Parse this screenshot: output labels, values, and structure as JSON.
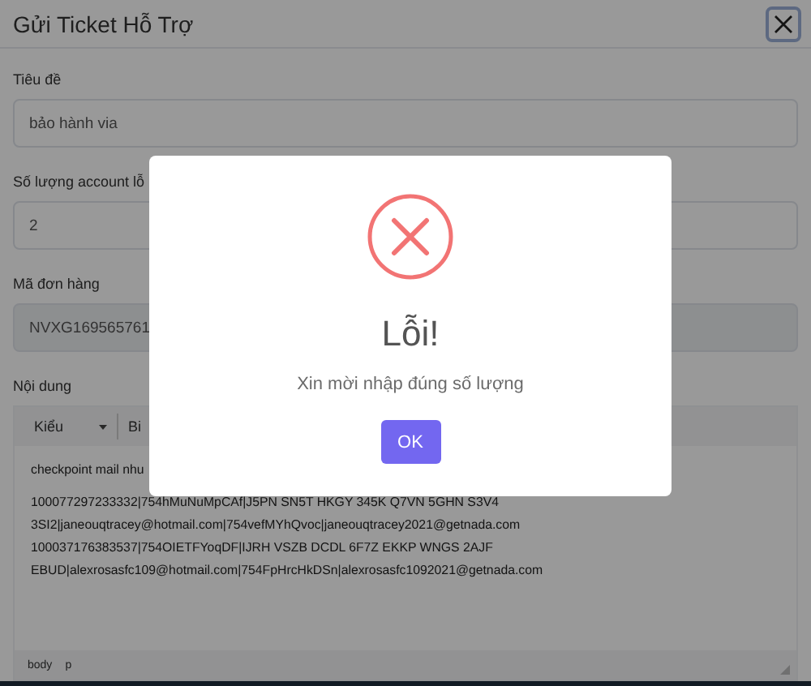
{
  "modal": {
    "title": "Gửi Ticket Hỗ Trợ",
    "fields": [
      {
        "label": "Tiêu đề",
        "value": "bảo hành via",
        "disabled": false
      },
      {
        "label": "Số lượng account lỗ",
        "value": "2",
        "disabled": false
      },
      {
        "label": "Mã đơn hàng",
        "value": "NVXG169565761",
        "disabled": true
      }
    ],
    "editor": {
      "label": "Nội dung",
      "style_dropdown": "Kiểu",
      "toolbar_text": "Bi",
      "lines": [
        "checkpoint mail nhu",
        "100077297233332|754hMuNuMpCAf|J5PN SN5T HKGY 345K Q7VN 5GHN S3V4",
        "3SI2|janeouqtracey@hotmail.com|754vefMYhQvoc|janeouqtracey2021@getnada.com",
        "100037176383537|754OIETFYoqDF|IJRH VSZB DCDL 6F7Z EKKP WNGS 2AJF",
        "EBUD|alexrosasfc109@hotmail.com|754FpHrcHkDSn|alexrosasfc1092021@getnada.com"
      ],
      "path": [
        "body",
        "p"
      ]
    }
  },
  "alert": {
    "kind": "error",
    "title": "Lỗi!",
    "message": "Xin mời nhập đúng số lượng",
    "button": "OK"
  }
}
